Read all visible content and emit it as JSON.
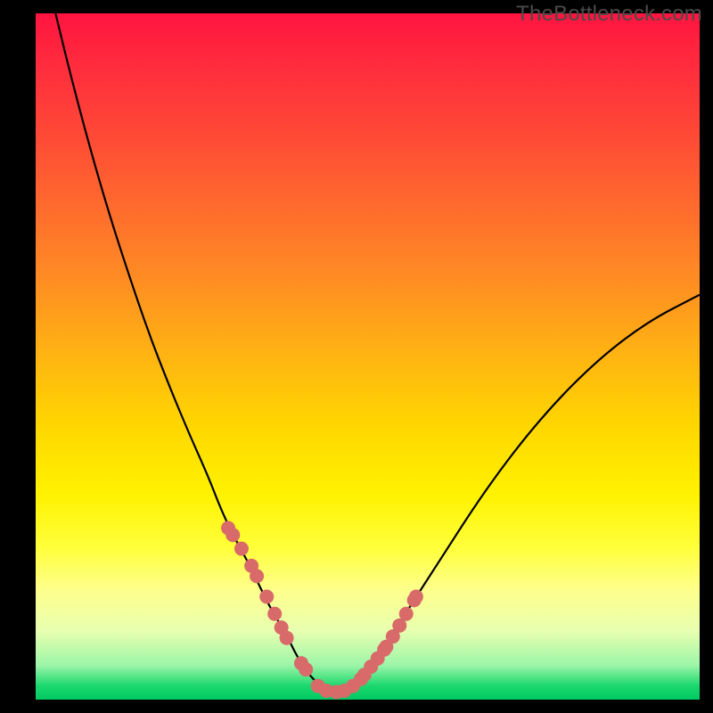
{
  "watermark": "TheBottleneck.com",
  "colors": {
    "background": "#000000",
    "curve_stroke": "#000000",
    "dot_fill": "#d86a6a",
    "dot_stroke": "#b84e4e"
  },
  "chart_data": {
    "type": "line",
    "title": "",
    "xlabel": "",
    "ylabel": "",
    "xlim": [
      0,
      100
    ],
    "ylim": [
      0,
      100
    ],
    "series": [
      {
        "name": "bottleneck-curve",
        "x": [
          3,
          5,
          8,
          11,
          14,
          17,
          20,
          23,
          26,
          28,
          30,
          32,
          33.5,
          35,
          36.5,
          38,
          39,
          40,
          41,
          42,
          43,
          44,
          45,
          46,
          47.5,
          49,
          51,
          53,
          55,
          58,
          62,
          66,
          70,
          74,
          78,
          82,
          86,
          90,
          94,
          98,
          100
        ],
        "y": [
          100,
          92,
          81,
          71,
          62,
          53.5,
          46,
          39,
          32.5,
          27.5,
          23.5,
          20,
          17,
          14,
          11.5,
          9,
          7,
          5.3,
          3.9,
          2.8,
          2,
          1.4,
          1.1,
          1.2,
          1.8,
          3,
          5,
          8,
          11.5,
          16,
          22,
          28,
          33.5,
          38.5,
          43,
          47,
          50.5,
          53.5,
          56,
          58,
          59
        ]
      }
    ],
    "dots": {
      "name": "highlight-points",
      "x": [
        29,
        29.7,
        31,
        32.5,
        33.3,
        34.8,
        36,
        37,
        37.8,
        40,
        40.7,
        42.5,
        43.8,
        45.3,
        46.5,
        47.8,
        49,
        49.5,
        50.5,
        51.5,
        52.5,
        52.8,
        53.8,
        54.8,
        55.8,
        57,
        57.3
      ],
      "y": [
        25,
        24,
        22,
        19.5,
        18,
        15,
        12.5,
        10.5,
        9,
        5.3,
        4.4,
        2,
        1.3,
        1.1,
        1.3,
        2,
        3,
        3.6,
        4.8,
        6,
        7.3,
        7.7,
        9.2,
        10.8,
        12.5,
        14.5,
        15
      ]
    }
  }
}
